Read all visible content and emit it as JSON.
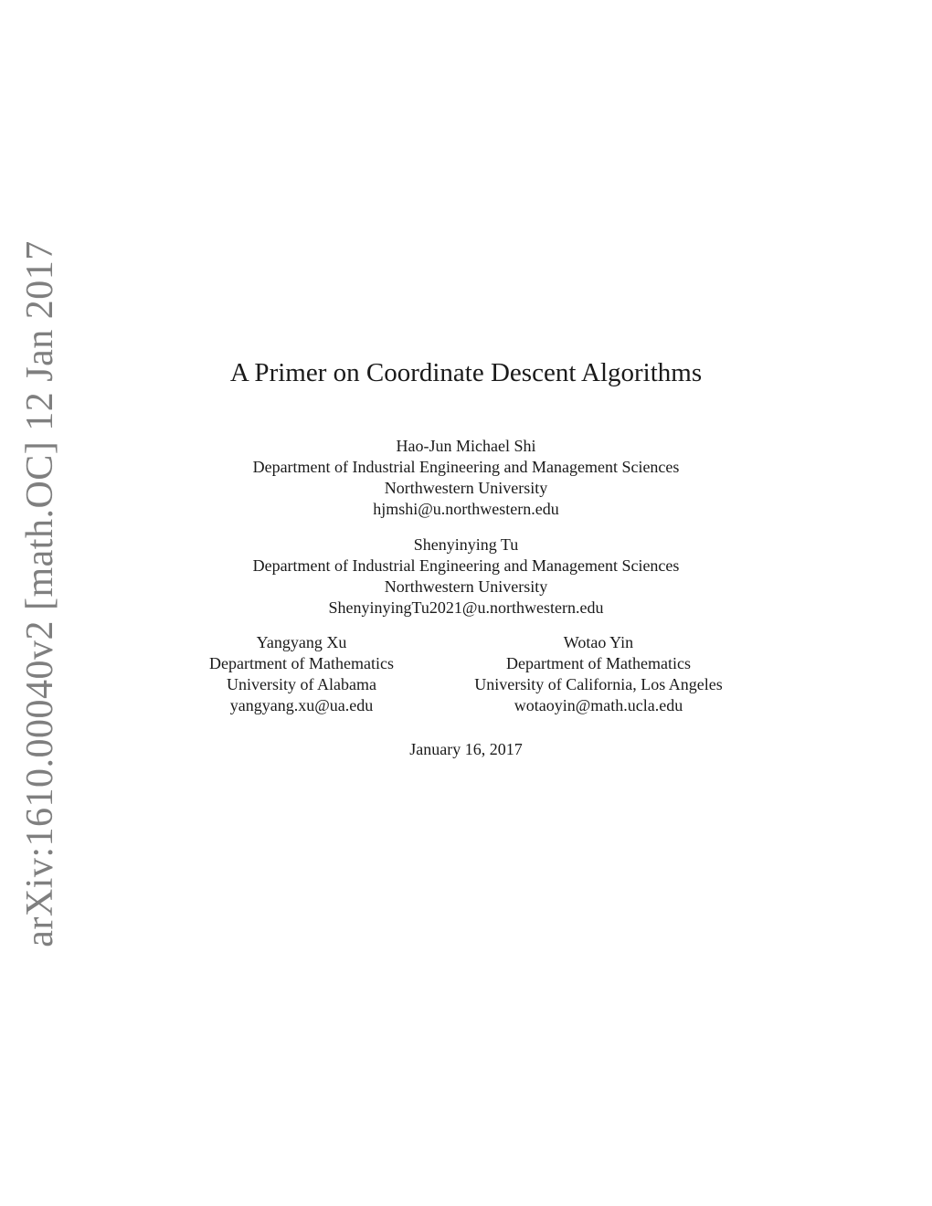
{
  "arxiv_stamp": "arXiv:1610.00040v2  [math.OC]  12 Jan 2017",
  "title": "A Primer on Coordinate Descent Algorithms",
  "authors": [
    {
      "name": "Hao-Jun Michael Shi",
      "department": "Department of Industrial Engineering and Management Sciences",
      "institution": "Northwestern University",
      "email": "hjmshi@u.northwestern.edu"
    },
    {
      "name": "Shenyinying Tu",
      "department": "Department of Industrial Engineering and Management Sciences",
      "institution": "Northwestern University",
      "email": "ShenyinyingTu2021@u.northwestern.edu"
    },
    {
      "name": "Yangyang Xu",
      "department": "Department of Mathematics",
      "institution": "University of Alabama",
      "email": "yangyang.xu@ua.edu"
    },
    {
      "name": "Wotao Yin",
      "department": "Department of Mathematics",
      "institution": "University of California, Los Angeles",
      "email": "wotaoyin@math.ucla.edu"
    }
  ],
  "date": "January 16, 2017"
}
